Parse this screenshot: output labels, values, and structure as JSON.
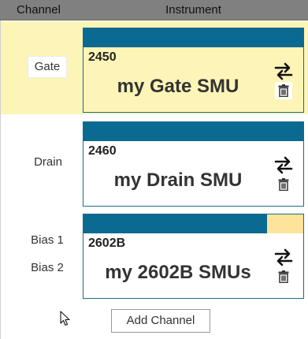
{
  "header": {
    "channel_label": "Channel",
    "instrument_label": "Instrument"
  },
  "rows": [
    {
      "channel_labels": [
        "Gate"
      ],
      "selected": true,
      "instrument": {
        "model": "2450",
        "name": "my Gate SMU"
      }
    },
    {
      "channel_labels": [
        "Drain"
      ],
      "selected": false,
      "instrument": {
        "model": "2460",
        "name": "my Drain SMU"
      }
    },
    {
      "channel_labels": [
        "Bias 1",
        "Bias 2"
      ],
      "selected": false,
      "instrument": {
        "model": "2602B",
        "name": "my 2602B SMUs"
      }
    }
  ],
  "actions": {
    "add_channel_label": "Add Channel"
  },
  "colors": {
    "header_bg": "#808080",
    "selected_row_bg": "#fdf5b7",
    "card_bar": "#0a6a91",
    "card_bar_secondary": "#fde49a",
    "card_border": "#1c6a8b"
  },
  "icons": {
    "swap": "swap-arrows-icon",
    "delete": "trash-icon",
    "cursor": "mouse-pointer-icon"
  }
}
